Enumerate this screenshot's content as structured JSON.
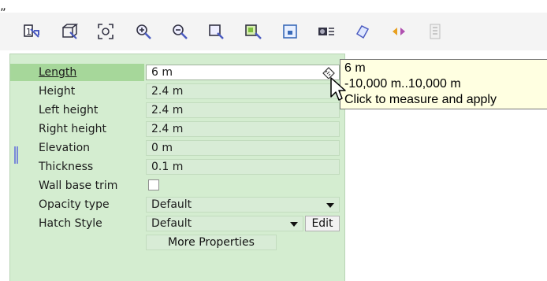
{
  "top_fragment": "„",
  "toolbar": {
    "buttons": [
      {
        "name": "view-1-icon"
      },
      {
        "name": "perspective-icon"
      },
      {
        "name": "zoom-extents-icon"
      },
      {
        "name": "zoom-in-icon"
      },
      {
        "name": "zoom-out-icon"
      },
      {
        "name": "zoom-window-icon"
      },
      {
        "name": "zoom-selection-icon"
      },
      {
        "name": "frame-icon"
      },
      {
        "name": "camera-icon"
      },
      {
        "name": "material-icon"
      },
      {
        "name": "mirror-icon"
      },
      {
        "name": "list-icon"
      }
    ]
  },
  "properties": {
    "rows": [
      {
        "label": "Length",
        "value": "6 m"
      },
      {
        "label": "Height",
        "value": "2.4 m"
      },
      {
        "label": "Left height",
        "value": "2.4 m"
      },
      {
        "label": "Right height",
        "value": "2.4 m"
      },
      {
        "label": "Elevation",
        "value": "0 m"
      },
      {
        "label": "Thickness",
        "value": "0.1 m"
      }
    ],
    "wall_base_trim": {
      "label": "Wall base trim"
    },
    "opacity_type": {
      "label": "Opacity type",
      "value": "Default"
    },
    "hatch_style": {
      "label": "Hatch Style",
      "value": "Default",
      "edit": "Edit"
    },
    "more_properties": "More Properties"
  },
  "tooltip": {
    "line1": "6 m",
    "line2": "-10,000 m..10,000 m",
    "line3": "Click to measure and apply"
  },
  "colors": {
    "panel": "#d4edd0",
    "selected": "#a6d79a",
    "tooltip": "#ffffe1"
  }
}
